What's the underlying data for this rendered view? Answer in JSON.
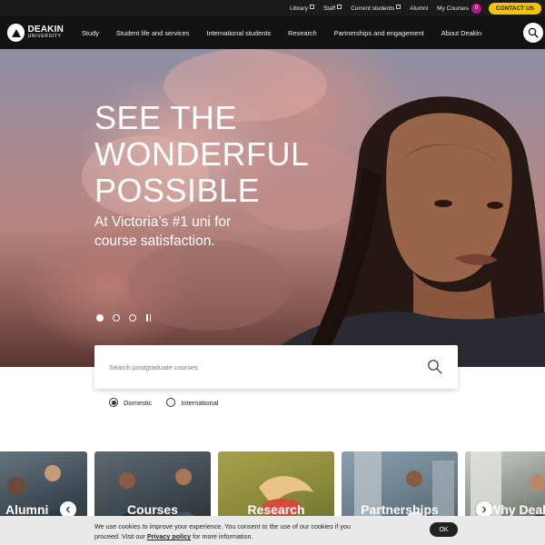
{
  "utility_bar": {
    "links": [
      {
        "label": "Library",
        "external": true
      },
      {
        "label": "Staff",
        "external": true
      },
      {
        "label": "Current students",
        "external": true
      },
      {
        "label": "Alumni",
        "external": false
      },
      {
        "label": "My Courses",
        "external": false
      }
    ],
    "my_courses_count": "0",
    "contact_label": "CONTACT US",
    "colors": {
      "badge": "#b5178a",
      "contact": "#f2c400"
    }
  },
  "nav": {
    "logo_line1": "DEAKIN",
    "logo_line2": "UNIVERSITY",
    "items": [
      "Study",
      "Student life and services",
      "International students",
      "Research",
      "Partnerships and engagement",
      "About Deakin"
    ],
    "search_icon": "search-icon"
  },
  "hero": {
    "title_lines": [
      "SEE THE",
      "WONDERFUL",
      "POSSIBLE"
    ],
    "subtitle_lines": [
      "At Victoria’s #1 uni for",
      "course satisfaction."
    ],
    "slide_count": 3,
    "active_slide": 1
  },
  "search": {
    "placeholder": "Search postgraduate courses",
    "options": [
      {
        "label": "Domestic",
        "selected": true
      },
      {
        "label": "International",
        "selected": false
      }
    ]
  },
  "cards": [
    "Alumni",
    "Courses",
    "Research",
    "Partnerships",
    "Why Deakin"
  ],
  "cookie": {
    "line1": "We use cookies to improve your experience. You consent to the use of our cookies if you",
    "line2_prefix": "proceed. Visit our ",
    "link": "Privacy policy",
    "line2_suffix": " for more information.",
    "ok_label": "OK"
  }
}
